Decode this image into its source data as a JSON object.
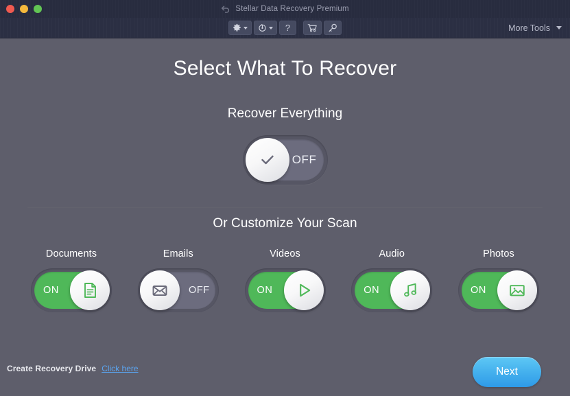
{
  "window": {
    "title": "Stellar Data Recovery Premium",
    "back_icon": "back-arrow-icon",
    "traffic_lights": [
      {
        "name": "close-button",
        "color": "#f05a50"
      },
      {
        "name": "minimize-button",
        "color": "#f5b93c"
      },
      {
        "name": "maximize-button",
        "color": "#62c554"
      }
    ]
  },
  "toolbar": {
    "buttons": [
      {
        "name": "settings-button",
        "icon": "gear-icon",
        "has_caret": true,
        "label": ""
      },
      {
        "name": "history-button",
        "icon": "clock-icon",
        "has_caret": true,
        "label": ""
      },
      {
        "name": "help-button",
        "icon": "question-icon",
        "has_caret": false,
        "label": "?"
      },
      {
        "name": "cart-button",
        "icon": "cart-icon",
        "has_caret": false,
        "label": ""
      },
      {
        "name": "activate-button",
        "icon": "key-icon",
        "has_caret": false,
        "label": ""
      }
    ],
    "more_tools_label": "More Tools",
    "more_tools_caret": "chevron-down-icon"
  },
  "main": {
    "page_title": "Select What To Recover",
    "recover_everything_label": "Recover Everything",
    "master_toggle": {
      "state": "off",
      "state_label": "OFF",
      "knob_icon": "check-icon"
    },
    "customize_label": "Or Customize Your Scan",
    "categories": [
      {
        "label": "Documents",
        "state": "on",
        "state_label": "ON",
        "icon": "document-icon"
      },
      {
        "label": "Emails",
        "state": "off",
        "state_label": "OFF",
        "icon": "envelope-icon"
      },
      {
        "label": "Videos",
        "state": "on",
        "state_label": "ON",
        "icon": "play-icon"
      },
      {
        "label": "Audio",
        "state": "on",
        "state_label": "ON",
        "icon": "music-note-icon"
      },
      {
        "label": "Photos",
        "state": "on",
        "state_label": "ON",
        "icon": "image-icon"
      }
    ]
  },
  "bottom": {
    "recovery_drive_label": "Create Recovery Drive",
    "recovery_drive_link": "Click here",
    "next_label": "Next"
  },
  "colors": {
    "titlebar_bg": "#282c3f",
    "toolbar_bg": "#2b2f43",
    "content_bg": "#5e5e6b",
    "accent_green": "#4fb859",
    "accent_blue": "#47b3ee",
    "link_blue": "#5ba4ef",
    "track_off": "#6c6c7e"
  }
}
